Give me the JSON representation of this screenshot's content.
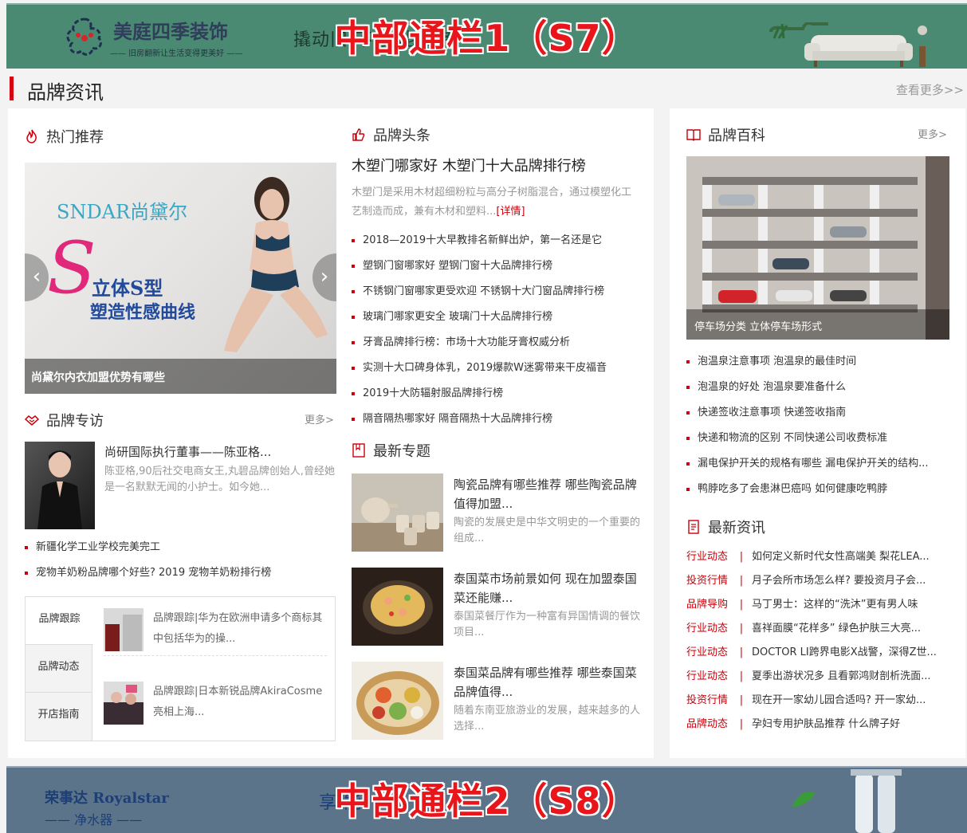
{
  "banner1": {
    "logo_title": "美庭四季装饰",
    "logo_sub": "—— 旧房翻新让生活变得更美好 ——",
    "slogan": "撬动旧 不惊 能装修",
    "overlay": "中部通栏1（S7）"
  },
  "banner2": {
    "logo_title": "荣事达 Royalstar",
    "logo_sub": "—— 净水器 ——",
    "slogan": "享 能",
    "overlay": "中部通栏2（S8）"
  },
  "section": {
    "title": "品牌资讯",
    "more": "查看更多>>"
  },
  "hot": {
    "title": "热门推荐",
    "brand_logo": "SNDAR尚黛尔",
    "promo_line1": "立体S型",
    "promo_line2": "塑造性感曲线",
    "big_letter": "S",
    "caption": "尚黛尔内衣加盟优势有哪些",
    "prev": "‹",
    "next": "›"
  },
  "headline": {
    "title": "品牌头条",
    "lead_title": "木塑门哪家好 木塑门十大品牌排行榜",
    "lead_desc": "木塑门是采用木材超细粉粒与高分子树脂混合，通过模塑化工艺制造而成，兼有木材和塑料...",
    "lead_more": "[详情]",
    "items": [
      "2018—2019十大早教排名新鲜出炉，第一名还是它",
      "塑钢门窗哪家好 塑钢门窗十大品牌排行榜",
      "不锈钢门窗哪家更受欢迎 不锈钢十大门窗品牌排行榜",
      "玻璃门哪家更安全 玻璃门十大品牌排行榜",
      "牙膏品牌排行榜：市场十大功能牙膏权威分析",
      "实测十大口碑身体乳，2019爆款W迷雾带来干皮福音",
      "2019十大防辐射服品牌排行榜",
      "隔音隔热哪家好 隔音隔热十大品牌排行榜"
    ]
  },
  "column": {
    "title": "品牌专访",
    "more": "更多>",
    "person_name": "尚研国际执行董事——陈亚格...",
    "person_desc": "陈亚格,90后社交电商女王,丸碧品牌创始人,曾经她是一名默默无闻的小护士。如今她...",
    "items": [
      "新疆化学工业学校完美完工",
      "宠物羊奶粉品牌哪个好些? 2019 宠物羊奶粉排行榜"
    ],
    "tabs": [
      "品牌跟踪",
      "品牌动态",
      "开店指南"
    ],
    "tab_items": [
      "品牌跟踪|华为在欧洲申请多个商标其中包括华为的操...",
      "品牌跟踪|日本新锐品牌AkiraCosme亮相上海..."
    ]
  },
  "topics": {
    "title": "最新专题",
    "items": [
      {
        "title": "陶瓷品牌有哪些推荐 哪些陶瓷品牌值得加盟...",
        "desc": "陶瓷的发展史是中华文明史的一个重要的组成..."
      },
      {
        "title": "泰国菜市场前景如何 现在加盟泰国菜还能赚...",
        "desc": "泰国菜餐厅作为一种富有异国情调的餐饮项目..."
      },
      {
        "title": "泰国菜品牌有哪些推荐 哪些泰国菜品牌值得...",
        "desc": "随着东南亚旅游业的发展，越来越多的人选择..."
      }
    ]
  },
  "wiki": {
    "title": "品牌百科",
    "more": "更多>",
    "caption": "停车场分类 立体停车场形式",
    "items": [
      "泡温泉注意事项 泡温泉的最佳时间",
      "泡温泉的好处 泡温泉要准备什么",
      "快递签收注意事项 快递签收指南",
      "快递和物流的区别 不同快递公司收费标准",
      "漏电保护开关的规格有哪些 漏电保护开关的结构...",
      "鸭脖吃多了会患淋巴癌吗 如何健康吃鸭脖"
    ]
  },
  "latest": {
    "title": "最新资讯",
    "sep": "|",
    "items": [
      {
        "cat": "行业动态",
        "text": "如何定义新时代女性高端美 梨花LEA..."
      },
      {
        "cat": "投资行情",
        "text": "月子会所市场怎么样? 要投资月子会..."
      },
      {
        "cat": "品牌导购",
        "text": "马丁男士：这样的“洗沐”更有男人味"
      },
      {
        "cat": "行业动态",
        "text": "喜祥面膜“花样多” 绿色护肤三大亮..."
      },
      {
        "cat": "行业动态",
        "text": "DOCTOR LI跨界电影X战警，深得Z世..."
      },
      {
        "cat": "行业动态",
        "text": "夏季出游状况多 且看郭鸿财剖析洗面..."
      },
      {
        "cat": "投资行情",
        "text": "现在开一家幼儿园合适吗? 开一家幼..."
      },
      {
        "cat": "品牌动态",
        "text": "孕妇专用护肤品推荐 什么牌子好"
      }
    ]
  },
  "colors": {
    "accent": "#c8000a",
    "banner1_bg": "#4b8a72",
    "banner2_bg": "#5b7489",
    "overlay_red": "#e8161b"
  }
}
